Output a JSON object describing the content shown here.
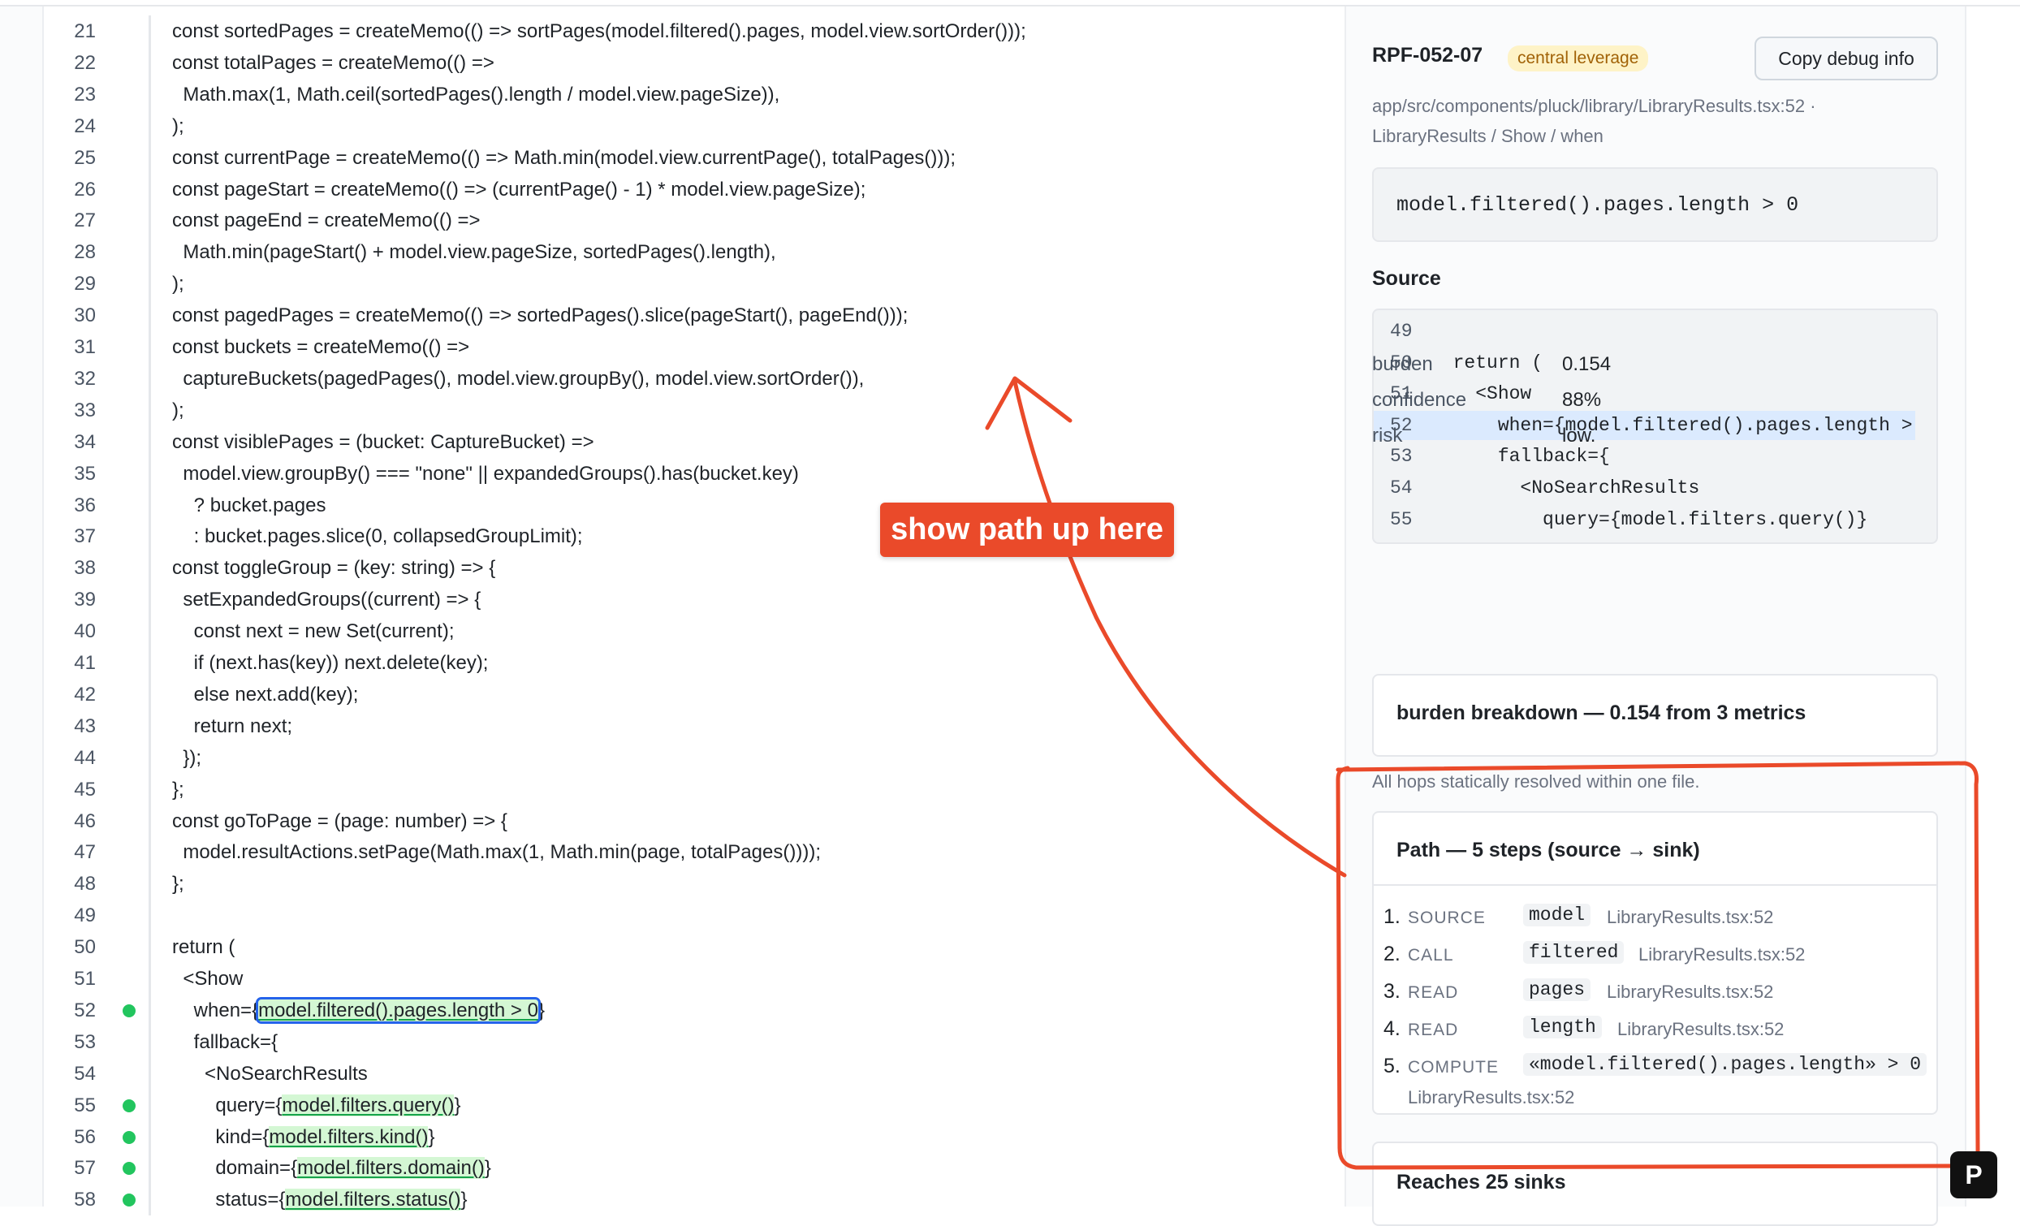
{
  "editor": {
    "lines": [
      {
        "n": "21",
        "code": "const sortedPages = createMemo(() => sortPages(model.filtered().pages, model.view.sortOrder()));"
      },
      {
        "n": "22",
        "code": "const totalPages = createMemo(() =>"
      },
      {
        "n": "23",
        "code": "  Math.max(1, Math.ceil(sortedPages().length / model.view.pageSize)),"
      },
      {
        "n": "24",
        "code": ");"
      },
      {
        "n": "25",
        "code": "const currentPage = createMemo(() => Math.min(model.view.currentPage(), totalPages()));"
      },
      {
        "n": "26",
        "code": "const pageStart = createMemo(() => (currentPage() - 1) * model.view.pageSize);"
      },
      {
        "n": "27",
        "code": "const pageEnd = createMemo(() =>"
      },
      {
        "n": "28",
        "code": "  Math.min(pageStart() + model.view.pageSize, sortedPages().length),"
      },
      {
        "n": "29",
        "code": ");"
      },
      {
        "n": "30",
        "code": "const pagedPages = createMemo(() => sortedPages().slice(pageStart(), pageEnd()));"
      },
      {
        "n": "31",
        "code": "const buckets = createMemo(() =>"
      },
      {
        "n": "32",
        "code": "  captureBuckets(pagedPages(), model.view.groupBy(), model.view.sortOrder()),"
      },
      {
        "n": "33",
        "code": ");"
      },
      {
        "n": "34",
        "code": "const visiblePages = (bucket: CaptureBucket) =>"
      },
      {
        "n": "35",
        "code": "  model.view.groupBy() === \"none\" || expandedGroups().has(bucket.key)"
      },
      {
        "n": "36",
        "code": "    ? bucket.pages"
      },
      {
        "n": "37",
        "code": "    : bucket.pages.slice(0, collapsedGroupLimit);"
      },
      {
        "n": "38",
        "code": "const toggleGroup = (key: string) => {"
      },
      {
        "n": "39",
        "code": "  setExpandedGroups((current) => {"
      },
      {
        "n": "40",
        "code": "    const next = new Set(current);"
      },
      {
        "n": "41",
        "code": "    if (next.has(key)) next.delete(key);"
      },
      {
        "n": "42",
        "code": "    else next.add(key);"
      },
      {
        "n": "43",
        "code": "    return next;"
      },
      {
        "n": "44",
        "code": "  });"
      },
      {
        "n": "45",
        "code": "};"
      },
      {
        "n": "46",
        "code": "const goToPage = (page: number) => {"
      },
      {
        "n": "47",
        "code": "  model.resultActions.setPage(Math.max(1, Math.min(page, totalPages())));"
      },
      {
        "n": "48",
        "code": "};"
      },
      {
        "n": "49",
        "code": ""
      },
      {
        "n": "50",
        "code": "return ("
      },
      {
        "n": "51",
        "code": "  <Show"
      },
      {
        "n": "52",
        "pre": "    when={",
        "hl": "model.filtered().pages.length > 0",
        "post": "}",
        "dot": true,
        "box": true
      },
      {
        "n": "53",
        "code": "    fallback={"
      },
      {
        "n": "54",
        "code": "      <NoSearchResults"
      },
      {
        "n": "55",
        "pre": "        query={",
        "hl": "model.filters.query()",
        "post": "}",
        "dot": true
      },
      {
        "n": "56",
        "pre": "        kind={",
        "hl": "model.filters.kind()",
        "post": "}",
        "dot": true
      },
      {
        "n": "57",
        "pre": "        domain={",
        "hl": "model.filters.domain()",
        "post": "}",
        "dot": true
      },
      {
        "n": "58",
        "pre": "        status={",
        "hl": "model.filters.status()",
        "post": "}",
        "dot": true
      }
    ]
  },
  "panel": {
    "id": "RPF-052-07",
    "badge": "central leverage",
    "copy_button": "Copy debug info",
    "path_line1": "app/src/components/pluck/library/LibraryResults.tsx:52 ·",
    "path_line2": "LibraryResults / Show / when",
    "expression": "model.filtered().pages.length > 0",
    "source_heading": "Source",
    "source_lines": [
      {
        "n": "49",
        "code": ""
      },
      {
        "n": "50",
        "code": "  return ("
      },
      {
        "n": "51",
        "code": "    <Show"
      },
      {
        "n": "52",
        "code": "      when={model.filtered().pages.length >",
        "active": true
      },
      {
        "n": "53",
        "code": "      fallback={"
      },
      {
        "n": "54",
        "code": "        <NoSearchResults"
      },
      {
        "n": "55",
        "code": "          query={model.filters.query()}"
      }
    ],
    "metrics": [
      {
        "label": "burden",
        "value": "0.154"
      },
      {
        "label": "confidence",
        "value": "88%"
      },
      {
        "label": "risk",
        "value": "low."
      }
    ],
    "burden_breakdown": "burden breakdown — 0.154 from 3 metrics",
    "note": "All hops statically resolved within one file.",
    "path_heading": "Path — 5 steps (source → sink)",
    "steps": [
      {
        "num": "1.",
        "kind": "SOURCE",
        "token": "model",
        "file": "LibraryResults.tsx:52"
      },
      {
        "num": "2.",
        "kind": "CALL",
        "token": "filtered",
        "file": "LibraryResults.tsx:52"
      },
      {
        "num": "3.",
        "kind": "READ",
        "token": "pages",
        "file": "LibraryResults.tsx:52"
      },
      {
        "num": "4.",
        "kind": "READ",
        "token": "length",
        "file": "LibraryResults.tsx:52"
      },
      {
        "num": "5.",
        "kind": "COMPUTE",
        "token": "«model.filtered().pages.length» > 0",
        "file": "LibraryResults.tsx:52"
      }
    ],
    "reaches": "Reaches 25 sinks"
  },
  "annotation": {
    "callout": "show path up here",
    "color": "#ea4a2a"
  },
  "fab_label": "P"
}
